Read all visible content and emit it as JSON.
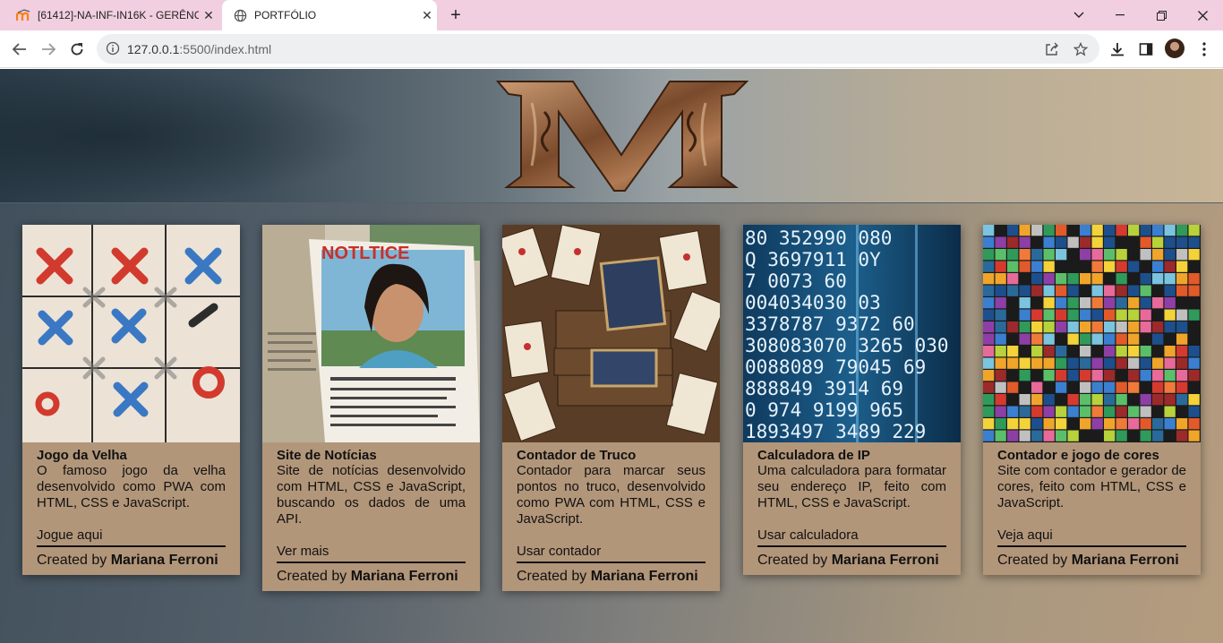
{
  "browser": {
    "tabs": [
      {
        "title": "[61412]-NA-INF-IN16K - GERÊNCIA",
        "active": false
      },
      {
        "title": "PORTFÓLIO",
        "active": true
      }
    ],
    "url_host": "127.0.0.1",
    "url_rest": ":5500/index.html"
  },
  "colors": {
    "card_bg": "#b2967a",
    "tabbar_bg": "#f1cfe0"
  },
  "banner": {
    "logo_letter": "M"
  },
  "cards": [
    {
      "title": "Jogo da Velha",
      "description": "O famoso jogo da velha desenvolvido como PWA com HTML, CSS e JavaScript.",
      "link": "Jogue aqui",
      "credit_prefix": "Created by",
      "credit_name": "Mariana Ferroni"
    },
    {
      "title": "Site de Notícias",
      "description": "Site de notícias desenvolvido com HTML, CSS e JavaScript, buscando os dados de uma API.",
      "link": "Ver mais",
      "credit_prefix": "Created by",
      "credit_name": "Mariana Ferroni",
      "image_text": "NOTLTICE"
    },
    {
      "title": "Contador de Truco",
      "description": "Contador para marcar seus pontos no truco, desenvolvido como PWA com HTML, CSS e JavaScript.",
      "link": "Usar contador",
      "credit_prefix": "Created by",
      "credit_name": "Mariana Ferroni"
    },
    {
      "title": "Calculadora de IP",
      "description": "Uma calculadora para formatar seu endereço IP, feito com HTML, CSS e JavaScript.",
      "link": "Usar calculadora",
      "credit_prefix": "Created by",
      "credit_name": "Mariana Ferroni",
      "image_text": [
        "80 352990 080",
        "Q 3697911 0Y",
        "7 0073 60",
        "004034030 03",
        "3378787 9372 60",
        "308083070 3265 030",
        "0088089 79045 69",
        "888849 3914 69",
        "0  974 9199 965",
        "1893497 3489 229"
      ]
    },
    {
      "title": "Contador e jogo de cores",
      "description": "Site com contador e gerador de cores, feito com HTML, CSS e JavaScript.",
      "link": "Veja aqui",
      "credit_prefix": "Created by",
      "credit_name": "Mariana Ferroni"
    }
  ]
}
